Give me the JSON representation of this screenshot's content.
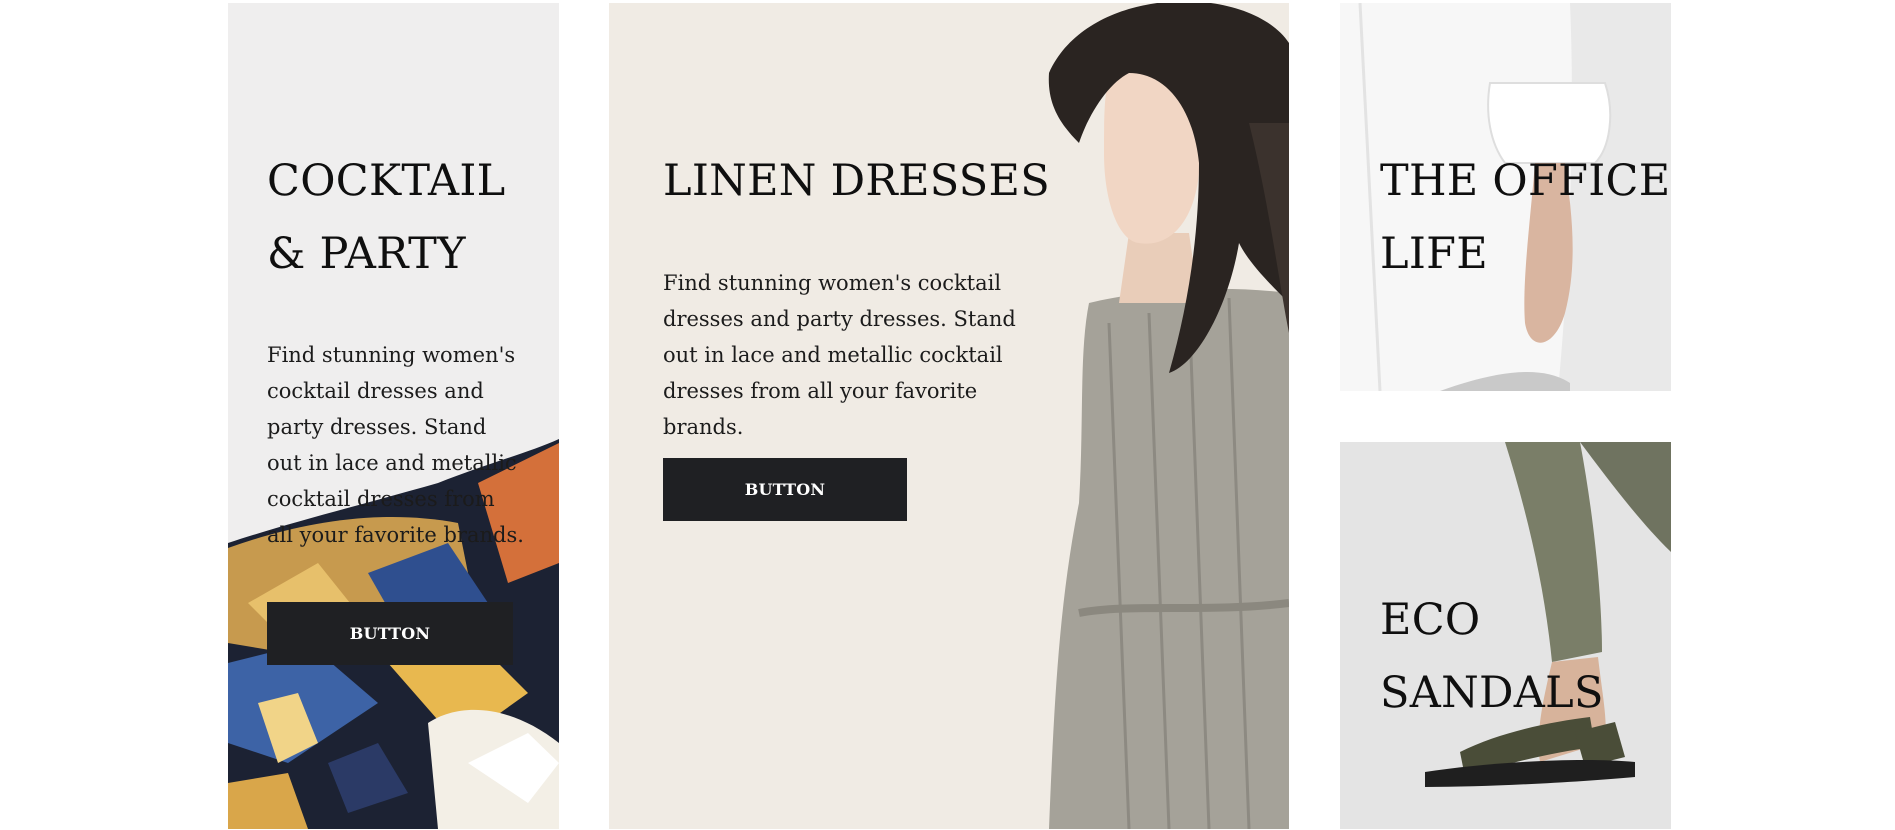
{
  "tiles": {
    "cocktail": {
      "title": "COCKTAIL\n& PARTY",
      "description": "Find stunning women's cocktail dresses and party dresses. Stand out in lace and metallic cocktail dresses from all your favorite brands.",
      "button_label": "BUTTON",
      "image": "floral-fabric"
    },
    "linen": {
      "title": "LINEN DRESSES",
      "description": "Find stunning women's cocktail dresses and party dresses. Stand out in lace and metallic cocktail dresses from all your favorite brands.",
      "button_label": "BUTTON",
      "image": "model-linen-dress"
    },
    "office": {
      "title": "THE OFFICE\nLIFE",
      "image": "white-shirt-sleeve"
    },
    "eco": {
      "title": "ECO\nSANDALS",
      "image": "olive-sandals"
    }
  },
  "colors": {
    "button_bg": "#1f2023",
    "button_text": "#ffffff",
    "text": "#0f0f0f",
    "cocktail_bg": "#efeeee",
    "linen_bg": "#f0ebe4",
    "office_bg": "#e9e9e9",
    "eco_bg": "#e6e6e6"
  }
}
